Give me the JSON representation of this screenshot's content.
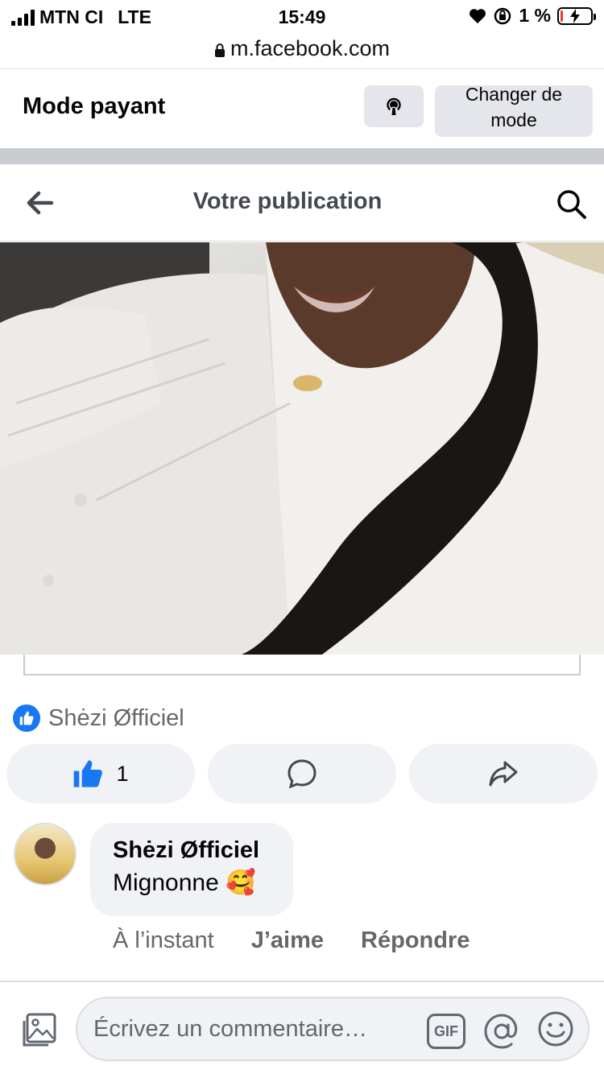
{
  "status_bar": {
    "carrier": "MTN CI",
    "network": "LTE",
    "time": "15:49",
    "battery_percent": "1 %",
    "battery_level": 0.01
  },
  "browser": {
    "url": "m.facebook.com"
  },
  "mode_banner": {
    "title": "Mode payant",
    "change_mode_label_line1": "Changer de",
    "change_mode_label_line2": "mode"
  },
  "header": {
    "title": "Votre publication"
  },
  "reactions": {
    "reactor_name": "Shėzi Øfficiel",
    "like_count": "1"
  },
  "comment": {
    "author": "Shėzi Øfficiel",
    "text": "Mignonne 🥰",
    "time": "À l’instant",
    "like_label": "J’aime",
    "reply_label": "Répondre"
  },
  "composer": {
    "placeholder": "Écrivez un commentaire…",
    "gif_label": "GIF"
  },
  "colors": {
    "brand_blue": "#1877f2",
    "secondary_text": "#65676b",
    "button_bg": "#f0f2f5"
  },
  "icons": [
    "signal-icon",
    "heart-icon",
    "rotation-lock-icon",
    "battery-icon",
    "lock-icon",
    "podcast-icon",
    "back-arrow-icon",
    "search-icon",
    "like-icon",
    "comment-icon",
    "share-icon",
    "photo-icon",
    "mention-icon",
    "emoji-icon"
  ]
}
